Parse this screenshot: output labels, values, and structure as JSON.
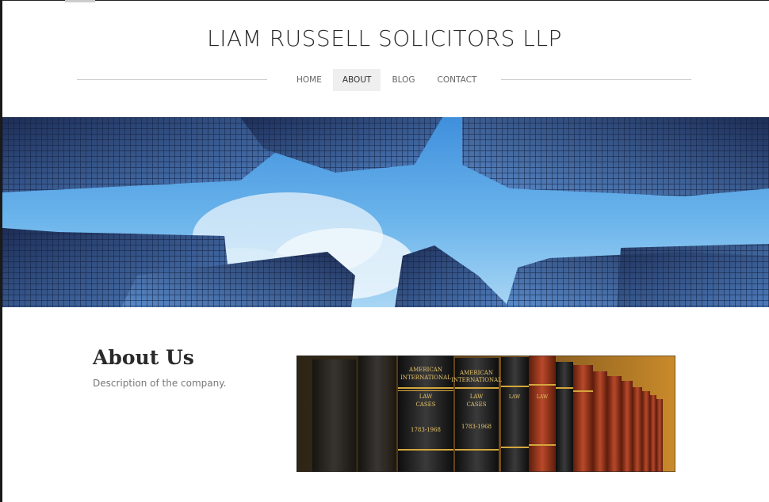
{
  "site": {
    "title": "LIAM RUSSELL SOLICITORS LLP"
  },
  "nav": {
    "items": [
      {
        "label": "HOME"
      },
      {
        "label": "ABOUT"
      },
      {
        "label": "BLOG"
      },
      {
        "label": "CONTACT"
      }
    ],
    "active": "ABOUT"
  },
  "about": {
    "heading": "About Us",
    "description": "Description of the company."
  },
  "books": {
    "spine_text": "AMERICAN INTERNATIONAL LAW CASES",
    "years": "1783-1968"
  },
  "colors": {
    "sky": "#5aa8e6",
    "glass": "#2c4f86",
    "leather_black": "#1c1c1c",
    "leather_red": "#a13a1c",
    "gold": "#d4a63c"
  }
}
